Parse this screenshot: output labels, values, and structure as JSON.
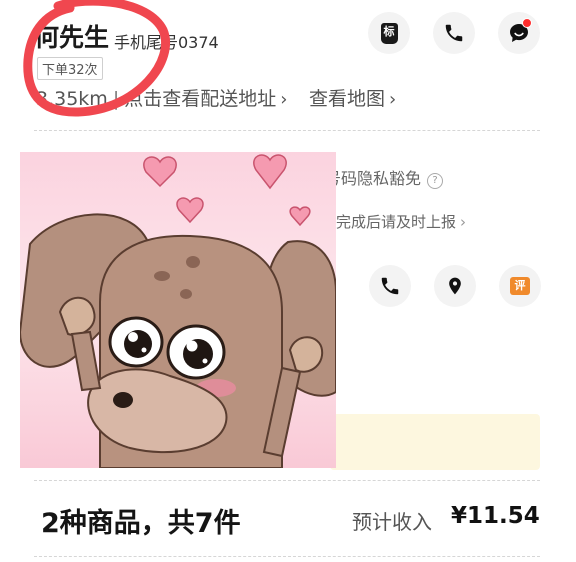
{
  "customer": {
    "name": "何先生",
    "phone_tail": "手机尾号0374",
    "order_count_badge": "下单32次"
  },
  "delivery": {
    "distance": "3.35km",
    "separator": "|",
    "view_address": "点击查看配送地址",
    "view_map": "查看地图",
    "chevron": "›"
  },
  "actions": {
    "tag_icon_text": "标",
    "review_icon_text": "评"
  },
  "partially_hidden": {
    "privacy_text": "号码隐私豁免",
    "info_icon_text": "?",
    "report_text": "完成后请及时上报",
    "report_chevron": "›"
  },
  "summary": {
    "items_title": "2种商品，共7件",
    "income_label": "预计收入",
    "income_value": "¥11.54"
  },
  "colors": {
    "annotation_red": "#f0474f",
    "notif_dot": "#ff2d2d",
    "review_orange": "#f08a2c",
    "notice_bg": "#fdf7df"
  }
}
